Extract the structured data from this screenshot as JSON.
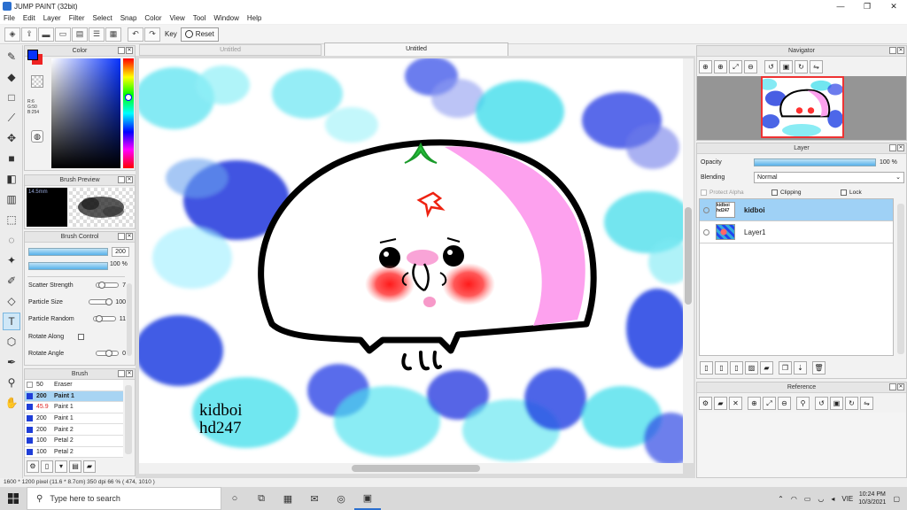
{
  "app": {
    "title": "JUMP PAINT (32bit)"
  },
  "window_controls": {
    "minimize": "—",
    "restore": "❐",
    "close": "✕"
  },
  "menu": [
    "File",
    "Edit",
    "Layer",
    "Filter",
    "Select",
    "Snap",
    "Color",
    "View",
    "Tool",
    "Window",
    "Help"
  ],
  "toolbar": {
    "key_label": "Key",
    "reset_label": "Reset"
  },
  "tabs": [
    {
      "label": "Untitled",
      "active": false
    },
    {
      "label": "Untitled",
      "active": true
    }
  ],
  "color_panel": {
    "title": "Color",
    "rgb_readout": [
      "R:6",
      "G:50",
      "B:254"
    ],
    "foreground": "#0632fe",
    "background": "#e22222"
  },
  "brush_preview": {
    "title": "Brush Preview",
    "size_text": "14.5mm"
  },
  "brush_control": {
    "title": "Brush Control",
    "size_value": "200",
    "opacity_value": "100 %",
    "rows": [
      {
        "label": "Scatter Strength",
        "value": "7"
      },
      {
        "label": "Particle Size",
        "value": "100"
      },
      {
        "label": "Particle Random",
        "value": "11"
      },
      {
        "label": "Rotate Along",
        "value": ""
      },
      {
        "label": "Rotate Angle",
        "value": "0"
      }
    ]
  },
  "brush_list": {
    "title": "Brush",
    "items": [
      {
        "size": "50",
        "name": "Eraser",
        "selected": false,
        "swatch": "#ffffff"
      },
      {
        "size": "200",
        "name": "Paint 1",
        "selected": true,
        "swatch": "#1f3ed8"
      },
      {
        "size": "45.9",
        "name": "Paint 1",
        "selected": false,
        "swatch": "#1f3ed8"
      },
      {
        "size": "200",
        "name": "Paint 1",
        "selected": false,
        "swatch": "#1f3ed8"
      },
      {
        "size": "200",
        "name": "Paint 2",
        "selected": false,
        "swatch": "#1f3ed8"
      },
      {
        "size": "100",
        "name": "Petal 2",
        "selected": false,
        "swatch": "#1f3ed8"
      },
      {
        "size": "100",
        "name": "Petal 2",
        "selected": false,
        "swatch": "#1f3ed8"
      }
    ]
  },
  "canvas": {
    "watermark_line1": "kidboi",
    "watermark_line2": "hd247"
  },
  "navigator": {
    "title": "Navigator"
  },
  "layer_panel": {
    "title": "Layer",
    "opacity_label": "Opacity",
    "opacity_value": "100 %",
    "blending_label": "Blending",
    "blending_value": "Normal",
    "protect_alpha": "Protect Alpha",
    "clipping": "Clipping",
    "lock": "Lock",
    "layers": [
      {
        "name": "kidboi",
        "thumb_text": "kidboi hd247",
        "selected": true
      },
      {
        "name": "Layer1",
        "thumb_text": "",
        "selected": false
      }
    ]
  },
  "reference": {
    "title": "Reference"
  },
  "status": {
    "text": "1600 * 1200 pixel   (11.6 * 8.7cm)  350 dpi   66 %   ( 474, 1010 )"
  },
  "taskbar": {
    "search_placeholder": "Type here to search",
    "lang": "VIE",
    "time": "10:24 PM",
    "date": "10/3/2021"
  }
}
